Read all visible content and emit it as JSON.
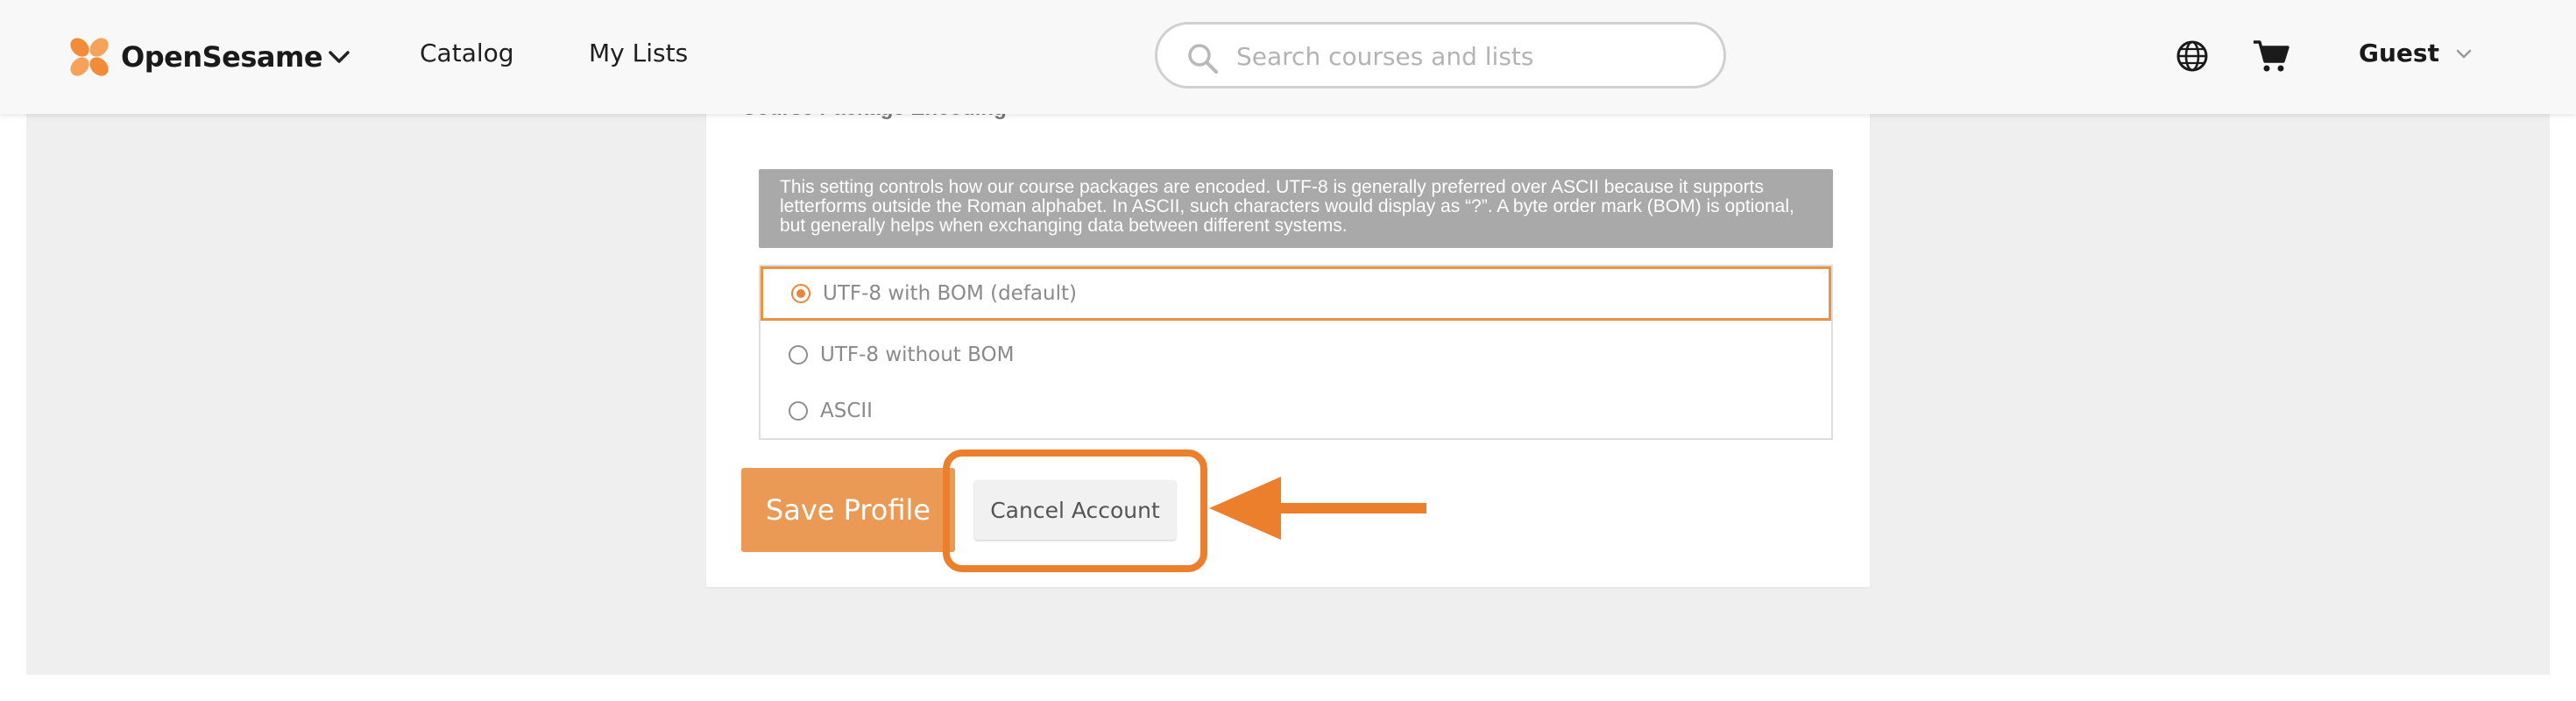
{
  "header": {
    "brand": "OpenSesame",
    "nav": [
      "Catalog",
      "My Lists"
    ],
    "search_placeholder": "Search courses and lists",
    "user": "Guest"
  },
  "icons": {
    "brand_logo": "opensesame-logo-icon",
    "brand_menu": "chevron-down-icon",
    "search": "search-icon",
    "language": "globe-icon",
    "cart": "cart-icon",
    "user_menu": "chevron-down-icon"
  },
  "encoding": {
    "title": "Course Package Encoding",
    "description": "This setting controls how our course packages are encoded. UTF-8 is generally preferred over ASCII because it supports letterforms outside the Roman alphabet. In ASCII, such characters would display as “?”. A byte order mark (BOM) is optional, but generally helps when exchanging data between different systems.",
    "options": [
      {
        "label": "UTF-8 with BOM (default)",
        "selected": true
      },
      {
        "label": "UTF-8 without BOM",
        "selected": false
      },
      {
        "label": "ASCII",
        "selected": false
      }
    ]
  },
  "actions": {
    "save_label": "Save Profile",
    "cancel_label": "Cancel Account"
  },
  "colors": {
    "accent": "#e8863a",
    "save_button": "#ea9a55",
    "annotation": "#ec7f2c",
    "info_box": "#a9a9a9",
    "page_background": "#efefef"
  }
}
